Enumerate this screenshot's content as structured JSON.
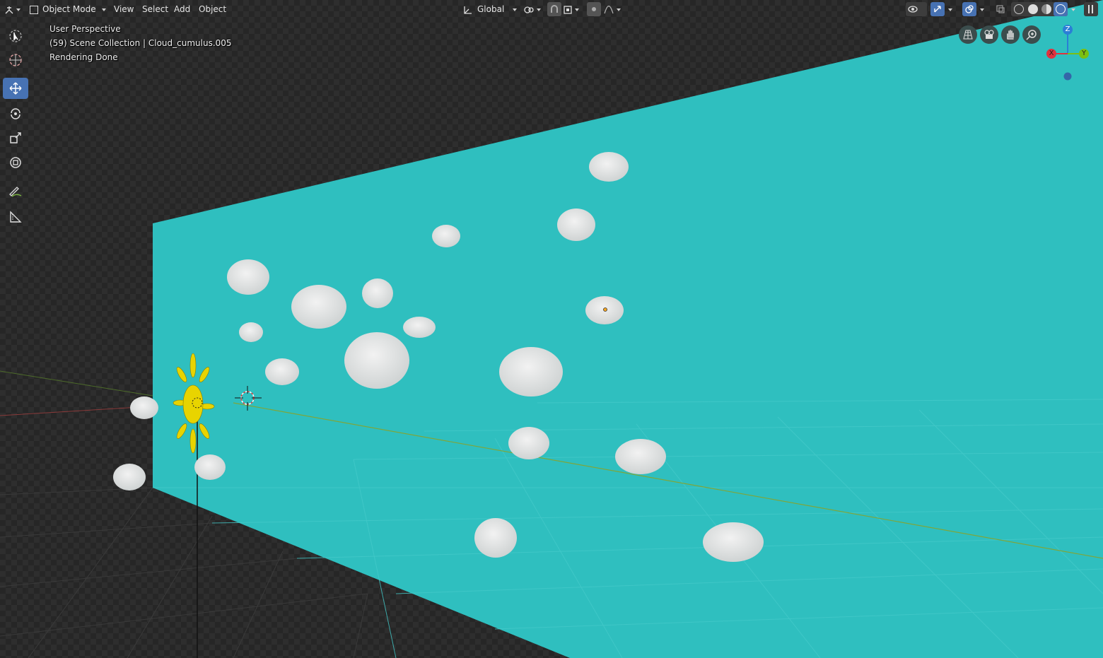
{
  "header": {
    "mode_label": "Object Mode",
    "menus": [
      "View",
      "Select",
      "Add",
      "Object"
    ],
    "orientation_label": "Global"
  },
  "overlay": {
    "view_name": "User Perspective",
    "collection_info": "(59) Scene Collection | Cloud_cumulus.005",
    "status": "Rendering Done"
  },
  "gizmo": {
    "x_label": "X",
    "y_label": "Y",
    "z_label": "Z",
    "x_color": "#e0323f",
    "y_color": "#7bc013",
    "z_color": "#2a7fd6"
  },
  "toolbar": {
    "tools": [
      "select-box-icon",
      "cursor-icon",
      "move-icon",
      "rotate-icon",
      "scale-icon",
      "transform-icon",
      "annotate-icon",
      "measure-icon"
    ],
    "active_tool": "move-icon"
  },
  "colors": {
    "backdrop": "#2fbfbf",
    "sun": "#e8d400",
    "cloud": "#e4e4e4",
    "active_tool": "#4772b3"
  }
}
